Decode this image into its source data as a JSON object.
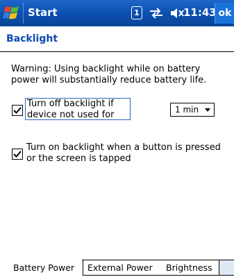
{
  "titlebar": {
    "title": "Start",
    "status_indicator": "1",
    "time": "11:43",
    "ok_label": "ok",
    "icons": [
      "windows-flag-icon",
      "connectivity-icon",
      "speaker-muted-icon"
    ],
    "colors": {
      "bar": "#0b4fae",
      "ok": "#1a73d9"
    }
  },
  "page": {
    "title": "Backlight",
    "warning": "Warning: Using backlight while on battery power will substantially reduce battery life.",
    "option1": {
      "label_line1": "Turn off backlight if",
      "label_line2": "device not used for",
      "checked": true,
      "timeout_value": "1 min"
    },
    "option2": {
      "label": "Turn on backlight when a button is pressed or the screen is tapped",
      "checked": true
    }
  },
  "tabs": [
    {
      "label": "Battery Power",
      "active": true
    },
    {
      "label": "External Power",
      "active": false
    },
    {
      "label": "Brightness",
      "active": false
    }
  ]
}
